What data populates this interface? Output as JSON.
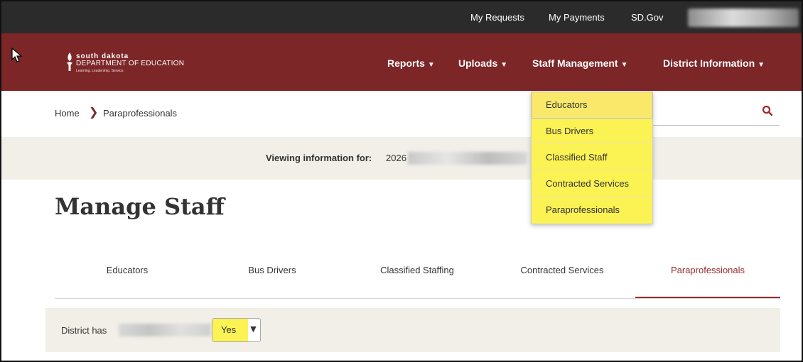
{
  "utility_bar": {
    "links": [
      "My Requests",
      "My Payments",
      "SD.Gov"
    ]
  },
  "brand": {
    "line1": "south dakota",
    "line2": "DEPARTMENT OF EDUCATION",
    "tagline": "Learning. Leadership. Service."
  },
  "main_nav": {
    "items": [
      {
        "label": "Reports"
      },
      {
        "label": "Uploads"
      },
      {
        "label": "Staff Management"
      },
      {
        "label": "District Information"
      }
    ]
  },
  "staff_dropdown": {
    "items": [
      "Educators",
      "Bus Drivers",
      "Classified Staff",
      "Contracted Services",
      "Paraprofessionals"
    ],
    "hovered": "Educators"
  },
  "breadcrumb": {
    "home": "Home",
    "separator": "❯",
    "current": "Paraprofessionals"
  },
  "viewing": {
    "label": "Viewing information for:",
    "value": "2026 S"
  },
  "page": {
    "title": "Manage Staff"
  },
  "tabs": {
    "items": [
      "Educators",
      "Bus Drivers",
      "Classified Staffing",
      "Contracted Services",
      "Paraprofessionals"
    ],
    "active": "Paraprofessionals"
  },
  "district": {
    "label": "District has",
    "select_value": "Yes"
  },
  "colors": {
    "brand_maroon": "#7d2628",
    "utility_dark": "#2b2b2b",
    "highlight_yellow": "#fbf254",
    "active_tab": "#9c2b2e",
    "panel_beige": "#f1efe8"
  }
}
